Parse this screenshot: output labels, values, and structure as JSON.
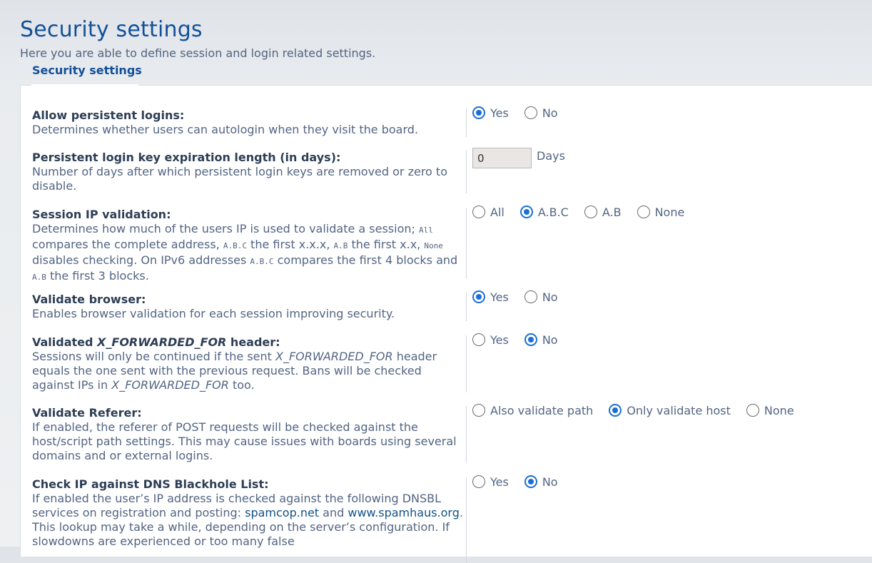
{
  "page": {
    "title": "Security settings",
    "description": "Here you are able to define session and login related settings."
  },
  "fieldset": {
    "legend": "Security settings"
  },
  "settings": {
    "persistent_logins": {
      "label": "Allow persistent logins:",
      "explain": "Determines whether users can autologin when they visit the board.",
      "options": [
        "Yes",
        "No"
      ],
      "selected": "Yes"
    },
    "persistent_expiration": {
      "label": "Persistent login key expiration length (in days):",
      "explain": "Number of days after which persistent login keys are removed or zero to disable.",
      "value": "0",
      "unit": "Days"
    },
    "ip_validation": {
      "label": "Session IP validation:",
      "explain_parts": [
        "Determines how much of the users IP is used to validate a session; ",
        "All",
        " compares the complete address, ",
        "A.B.C",
        " the first x.x.x, ",
        "A.B",
        " the first x.x, ",
        "None",
        " disables checking. On IPv6 addresses ",
        "A.B.C",
        " compares the first 4 blocks and ",
        "A.B",
        " the first 3 blocks."
      ],
      "options": [
        "All",
        "A.B.C",
        "A.B",
        "None"
      ],
      "selected": "A.B.C"
    },
    "browser_check": {
      "label": "Validate browser:",
      "explain": "Enables browser validation for each session improving security.",
      "options": [
        "Yes",
        "No"
      ],
      "selected": "Yes"
    },
    "forwarded_for": {
      "label_pre": "Validated ",
      "label_em": "X_FORWARDED_FOR",
      "label_post": " header:",
      "explain_parts": [
        "Sessions will only be continued if the sent ",
        "X_FORWARDED_FOR",
        " header equals the one sent with the previous request. Bans will be checked against IPs in ",
        "X_FORWARDED_FOR",
        " too."
      ],
      "options": [
        "Yes",
        "No"
      ],
      "selected": "No"
    },
    "referer": {
      "label": "Validate Referer:",
      "explain": "If enabled, the referer of POST requests will be checked against the host/script path settings. This may cause issues with boards using several domains and or external logins.",
      "options": [
        "Also validate path",
        "Only validate host",
        "None"
      ],
      "selected": "Only validate host"
    },
    "dnsbl": {
      "label": "Check IP against DNS Blackhole List:",
      "explain_parts": [
        "If enabled the user’s IP address is checked against the following DNSBL services on registration and posting: ",
        "spamcop.net",
        " and ",
        "www.spamhaus.org",
        ". This lookup may take a while, depending on the server’s configuration. If slowdowns are experienced or too many false"
      ],
      "options": [
        "Yes",
        "No"
      ],
      "selected": "No"
    }
  }
}
